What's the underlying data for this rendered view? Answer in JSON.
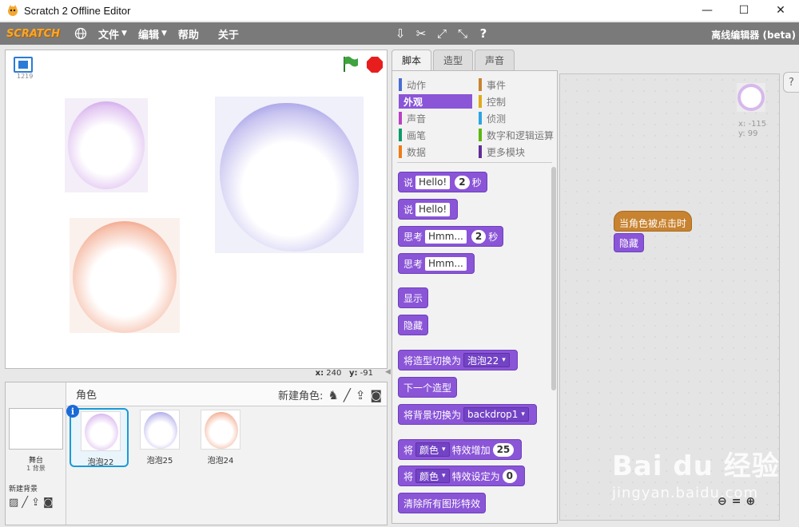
{
  "window": {
    "title": "Scratch 2 Offline Editor",
    "minimize": "—",
    "maximize": "☐",
    "close": "✕"
  },
  "menubar": {
    "logo": "SCRATCH",
    "file": "文件",
    "edit": "编辑",
    "help": "帮助",
    "about": "关于",
    "offline_label": "离线编辑器 (beta)",
    "tools": [
      "duplicate-icon",
      "delete-icon",
      "grow-icon",
      "shrink-icon",
      "help-icon"
    ]
  },
  "stage": {
    "version": "1219",
    "mouse_x_label": "x:",
    "mouse_x": "240",
    "mouse_y_label": "y:",
    "mouse_y": "-91"
  },
  "sprites_panel": {
    "header": "角色",
    "new_sprite_label": "新建角色:",
    "stage_name": "舞台",
    "stage_backdrops": "1 背景",
    "new_backdrop_label": "新建背景",
    "sprites": [
      {
        "name": "泡泡22",
        "color": "#c58ae8",
        "selected": true
      },
      {
        "name": "泡泡25",
        "color": "#8c84e0",
        "selected": false
      },
      {
        "name": "泡泡24",
        "color": "#ee7a55",
        "selected": false
      }
    ]
  },
  "tabs": [
    "脚本",
    "造型",
    "声音"
  ],
  "categories": [
    {
      "label": "动作",
      "color": "#4a6cd4"
    },
    {
      "label": "事件",
      "color": "#c88330"
    },
    {
      "label": "外观",
      "color": "#8a55d7"
    },
    {
      "label": "控制",
      "color": "#e1a91a"
    },
    {
      "label": "声音",
      "color": "#bb42c3"
    },
    {
      "label": "侦测",
      "color": "#2ca5e2"
    },
    {
      "label": "画笔",
      "color": "#0e9a6c"
    },
    {
      "label": "数字和逻辑运算",
      "color": "#5cb712"
    },
    {
      "label": "数据",
      "color": "#ee7d16"
    },
    {
      "label": "更多模块",
      "color": "#632d99"
    }
  ],
  "blocks": {
    "say_secs": {
      "a": "说",
      "text": "Hello!",
      "num": "2",
      "b": "秒"
    },
    "say": {
      "a": "说",
      "text": "Hello!"
    },
    "think_secs": {
      "a": "思考",
      "text": "Hmm...",
      "num": "2",
      "b": "秒"
    },
    "think": {
      "a": "思考",
      "text": "Hmm..."
    },
    "show": "显示",
    "hide": "隐藏",
    "switch_costume": {
      "a": "将造型切换为",
      "value": "泡泡22"
    },
    "next_costume": "下一个造型",
    "switch_backdrop": {
      "a": "将背景切换为",
      "value": "backdrop1"
    },
    "change_effect": {
      "a": "将",
      "effect": "颜色",
      "b": "特效增加",
      "num": "25"
    },
    "set_effect": {
      "a": "将",
      "effect": "颜色",
      "b": "特效设定为",
      "num": "0"
    },
    "clear_effects": "清除所有图形特效"
  },
  "script_area": {
    "preview_x": "x: -115",
    "preview_y": "y: 99",
    "hat_block": "当角色被点击时",
    "hide_block": "隐藏",
    "help_tab": "?",
    "zoom": [
      "zoom-out-icon",
      "zoom-reset-icon",
      "zoom-in-icon"
    ]
  },
  "watermark": {
    "top": "Bai du 经验",
    "bottom": "jingyan.baidu.com"
  }
}
